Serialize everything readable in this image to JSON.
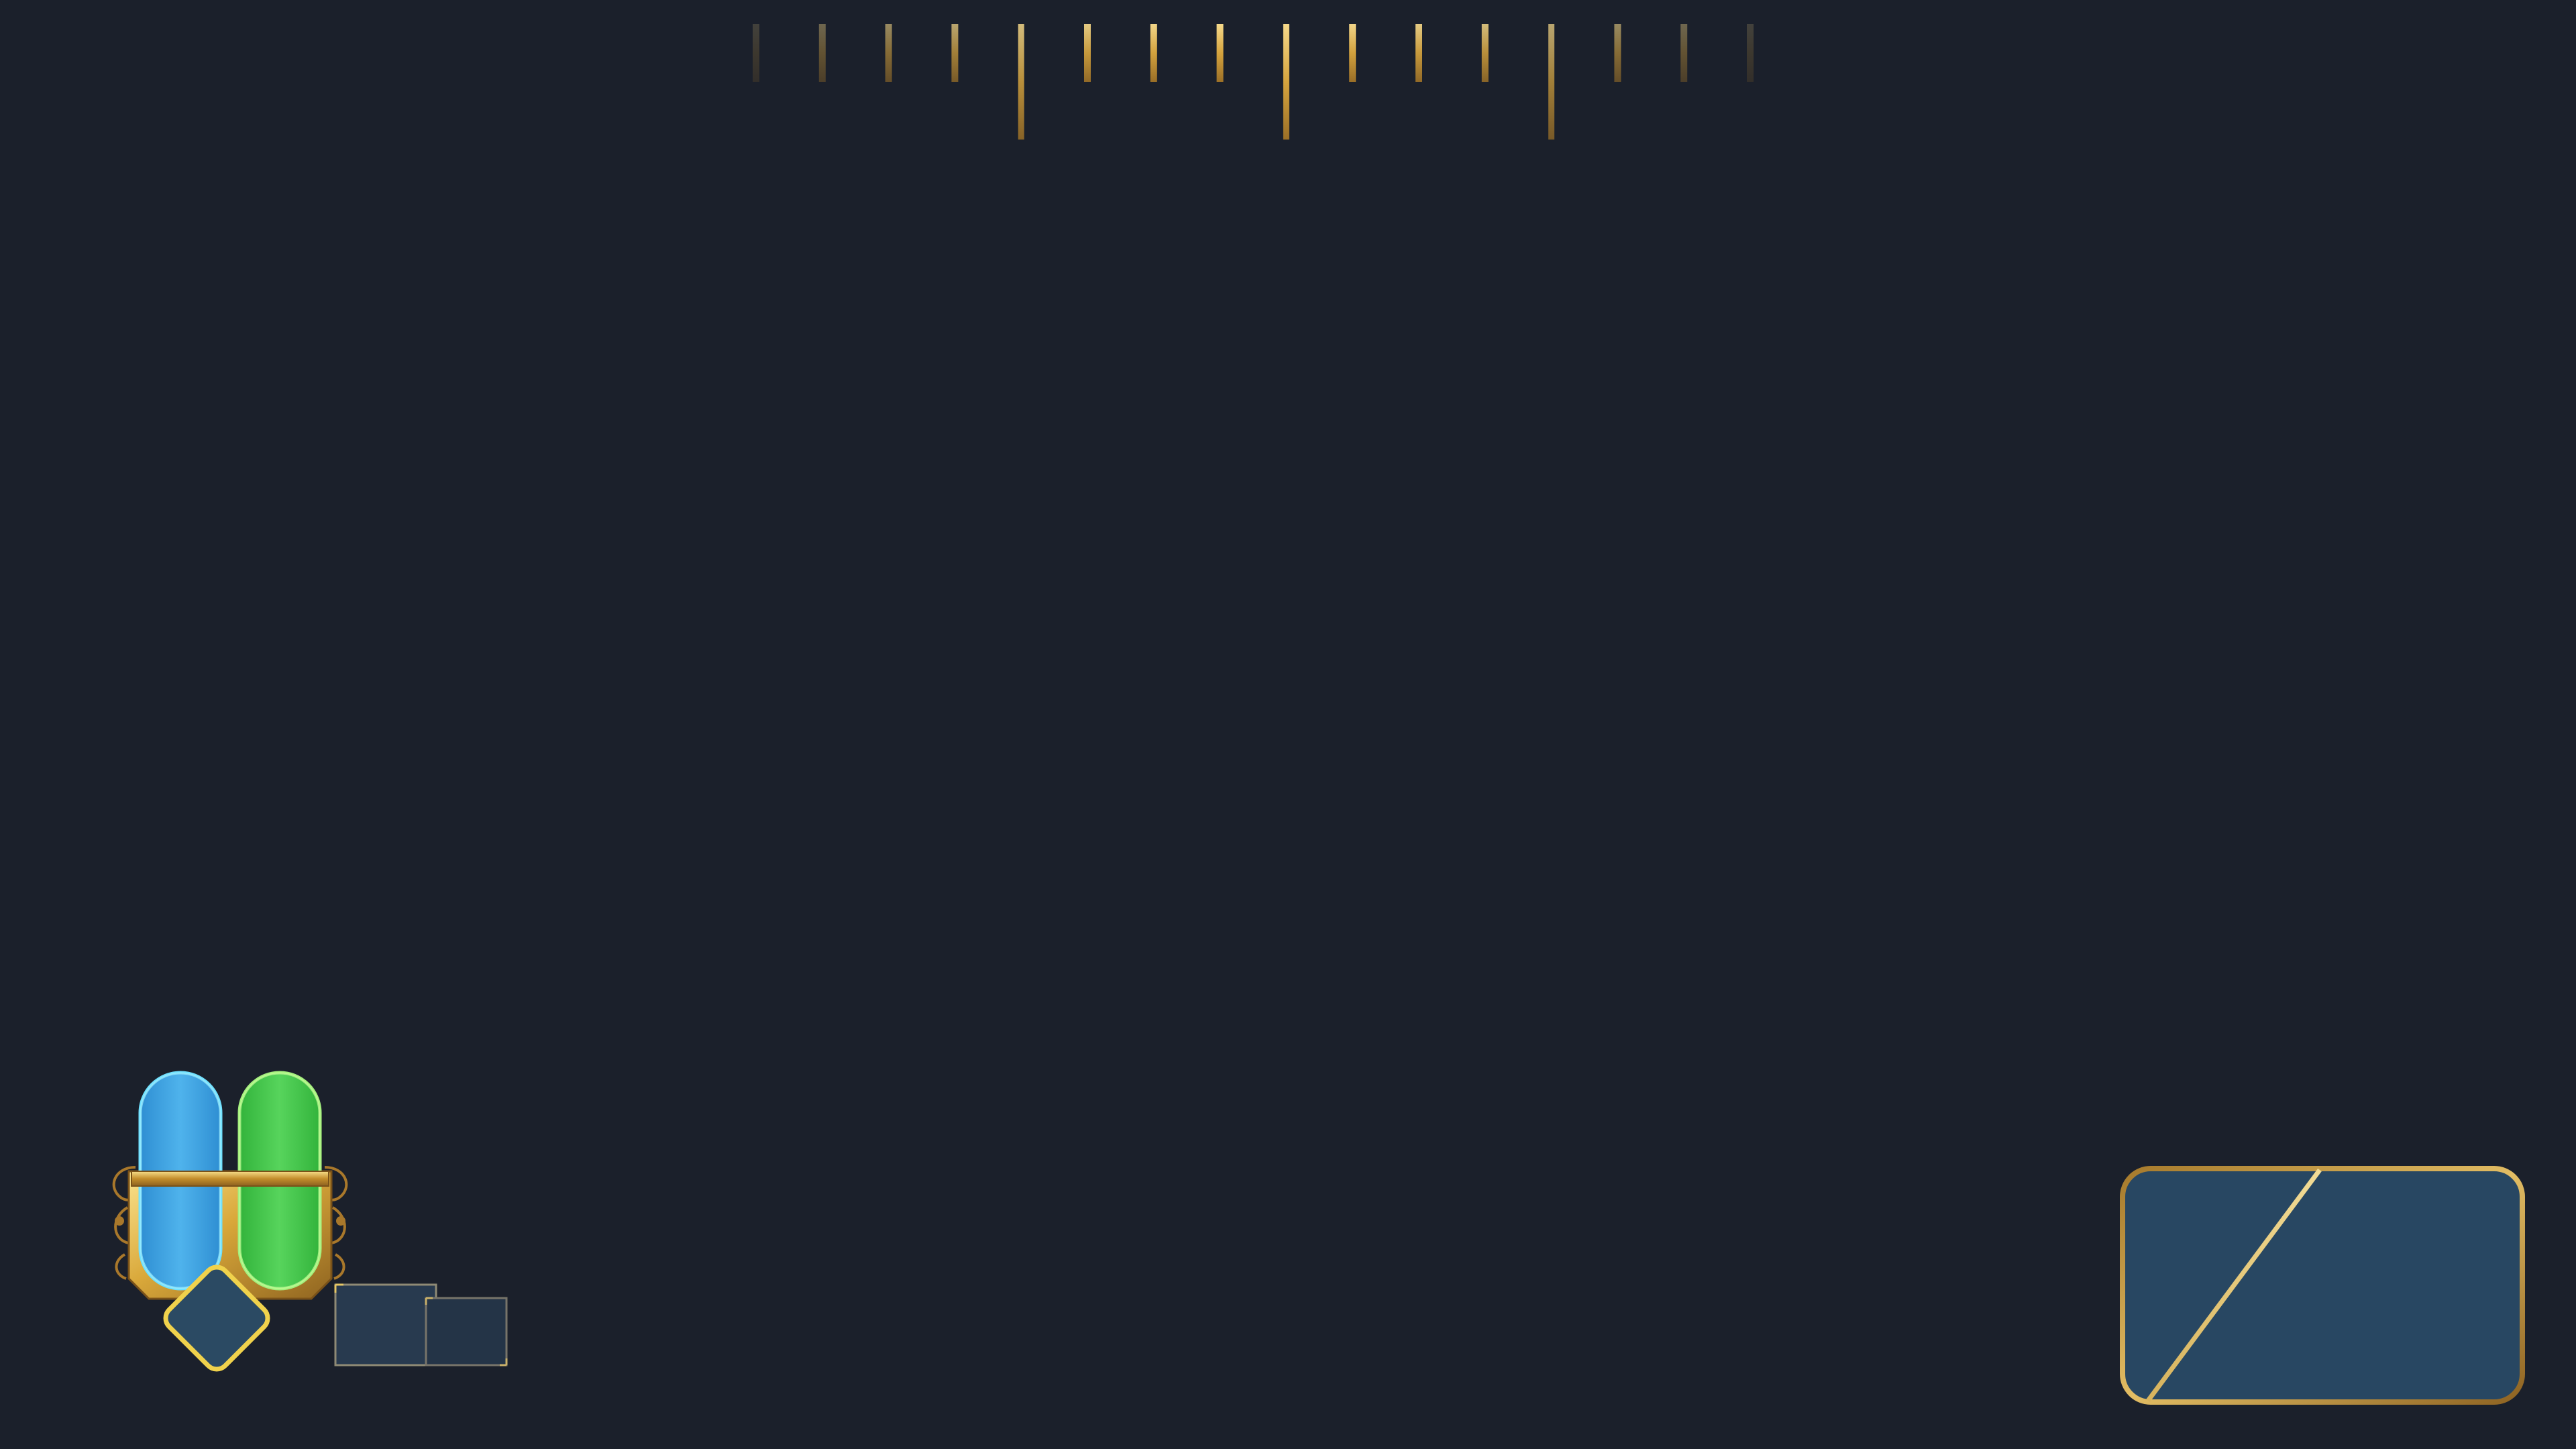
{
  "colors": {
    "background": "#1b202b",
    "gold": "#d8ac45",
    "gold_light": "#f4d27a",
    "gold_dark": "#9a6f24",
    "mana": "#3fa7e4",
    "mana_glow": "#6fe0ff",
    "stamina": "#43c64d",
    "stamina_glow": "#a4f07e",
    "panel": "#2a3f57"
  },
  "hud": {
    "compass": {
      "icon": "compass-heading-bar"
    },
    "vitals": {
      "mana_fraction": 1.0,
      "stamina_fraction": 1.0,
      "mana_icon": "mana-vial-icon",
      "stamina_icon": "stamina-vial-icon"
    },
    "ability": {
      "icon": "ability-diamond-icon"
    },
    "quick_slots": {
      "count": 2
    },
    "minimap": {
      "icon": "minimap-panel"
    }
  }
}
